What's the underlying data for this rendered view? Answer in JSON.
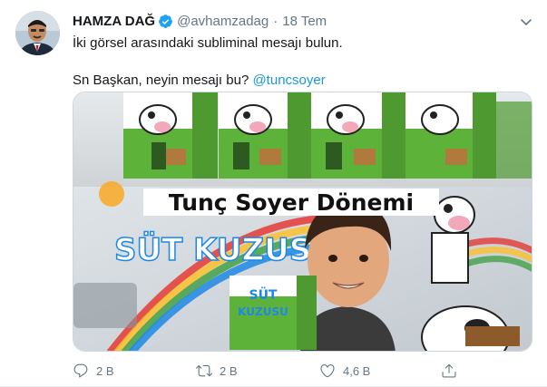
{
  "tweet": {
    "author_name": "HAMZA DAĞ",
    "handle": "@avhamzadag",
    "separator": "·",
    "time": "18 Tem",
    "verified": true,
    "text_line1": "İki görsel arasındaki subliminal mesajı bulun.",
    "text_line2_prefix": "Sn Başkan, neyin mesajı bu? ",
    "mention": "@tuncsoyer",
    "media": {
      "top_banner_text": "Tunç Soyer Dönemi",
      "van_text": "SÜT KUZUSU",
      "carton_text_line1": "SÜT",
      "carton_text_line2": "KUZUSU"
    },
    "actions": {
      "replies": "2 B",
      "retweets": "2 B",
      "likes": "4,6 B"
    }
  },
  "colors": {
    "text": "#14171a",
    "secondary": "#657786",
    "link": "#1b95e0",
    "verified": "#1da1f2",
    "carton_green": "#5db33a"
  }
}
